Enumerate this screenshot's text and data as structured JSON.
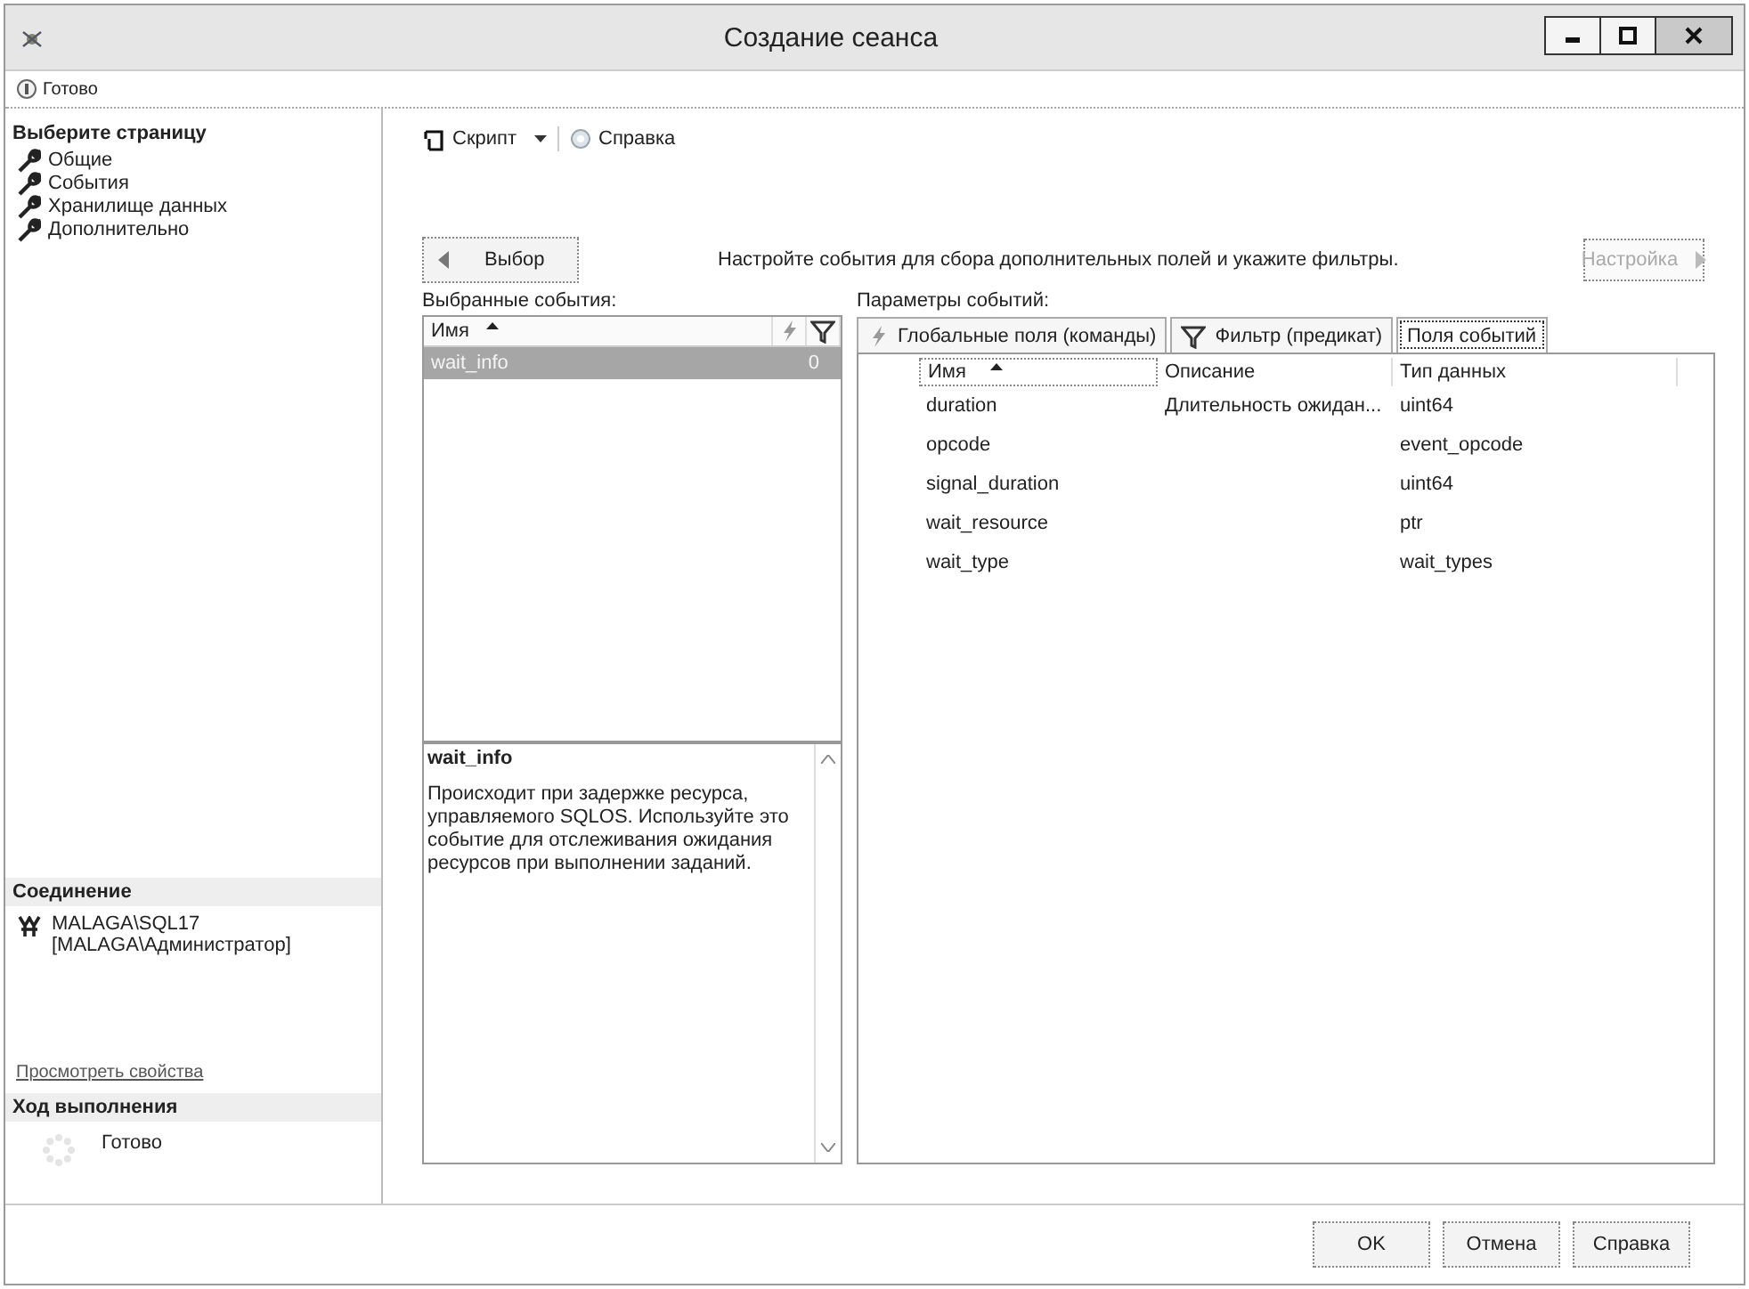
{
  "window": {
    "title": "Создание сеанса"
  },
  "status": "Готово",
  "sidebar": {
    "heading": "Выберите страницу",
    "items": [
      {
        "label": "Общие"
      },
      {
        "label": "События"
      },
      {
        "label": "Хранилище данных"
      },
      {
        "label": "Дополнительно"
      }
    ],
    "connection": {
      "heading": "Соединение",
      "server": "MALAGA\\SQL17",
      "user": "[MALAGA\\Администратор]",
      "link": "Просмотреть свойства"
    },
    "progress": {
      "heading": "Ход выполнения",
      "state": "Готово"
    }
  },
  "toolbar": {
    "script": "Скрипт",
    "help": "Справка"
  },
  "back_button": {
    "label": "Выбор"
  },
  "instruction": "Настройте события для сбора дополнительных полей и укажите фильтры.",
  "next_button": {
    "label": "Настройка",
    "disabled": true
  },
  "selected_events": {
    "label": "Выбранные события:",
    "columns": [
      "Имя"
    ],
    "rows": [
      {
        "name": "wait_info",
        "count": "0",
        "selected": true
      }
    ]
  },
  "description": {
    "title": "wait_info",
    "text": "Происходит при задержке ресурса, управляемого SQLOS. Используйте это событие для отслеживания ожидания ресурсов при выполнении заданий."
  },
  "event_params": {
    "label": "Параметры событий:",
    "tabs": [
      {
        "label": "Глобальные поля (команды)",
        "kind": "commands",
        "selected": false
      },
      {
        "label": "Фильтр (предикат)",
        "kind": "predicate",
        "selected": false
      },
      {
        "label": "Поля событий",
        "kind": "fields",
        "selected": true
      }
    ],
    "columns": [
      "Имя",
      "Описание",
      "Тип данных"
    ],
    "rows": [
      {
        "name": "duration",
        "description": "Длительность ожидан...",
        "type": "uint64"
      },
      {
        "name": "opcode",
        "type": "event_opcode"
      },
      {
        "name": "signal_duration",
        "type": "uint64"
      },
      {
        "name": "wait_resource",
        "type": "ptr"
      },
      {
        "name": "wait_type",
        "type": "wait_types"
      }
    ]
  },
  "buttons": [
    "OK",
    "Отмена",
    "Справка"
  ]
}
